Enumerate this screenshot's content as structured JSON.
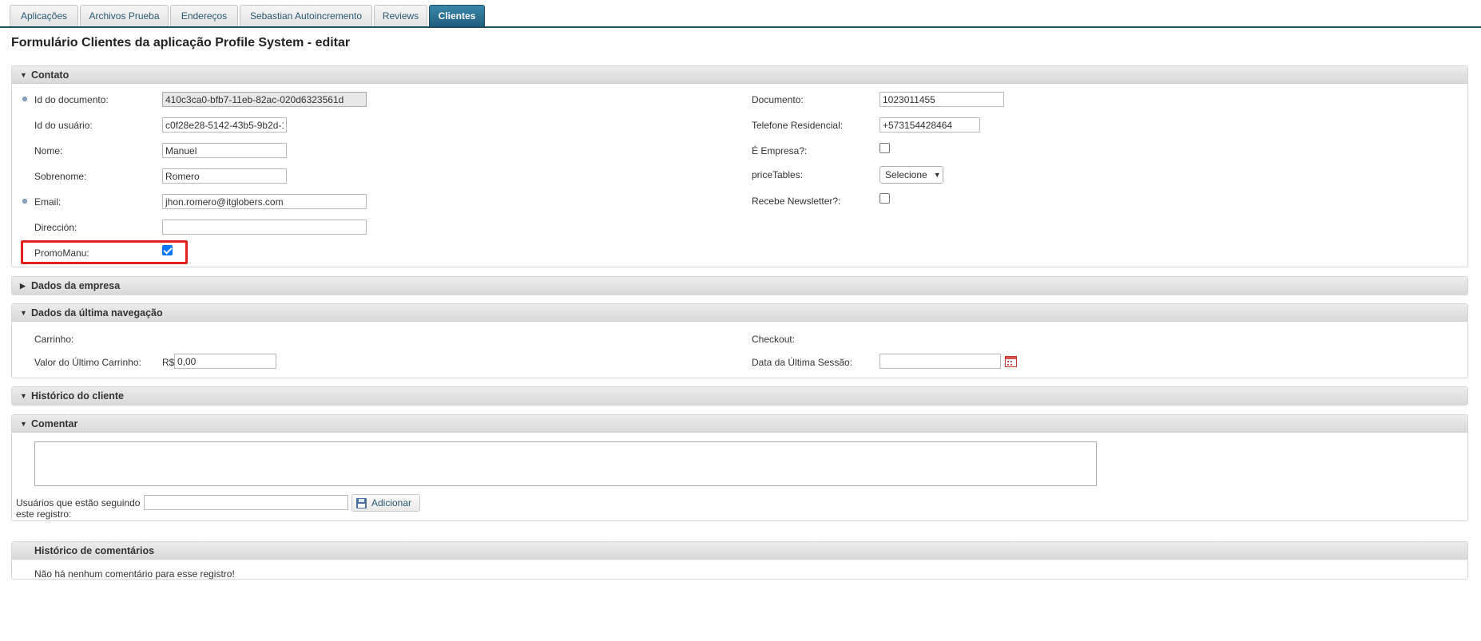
{
  "tabs": [
    {
      "label": "Aplicações",
      "active": false
    },
    {
      "label": "Archivos Prueba",
      "active": false
    },
    {
      "label": "Endereços",
      "active": false
    },
    {
      "label": "Sebastian Autoincremento",
      "active": false
    },
    {
      "label": "Reviews",
      "active": false
    },
    {
      "label": "Clientes",
      "active": true
    }
  ],
  "page_title": "Formulário Clientes da aplicação Profile System - editar",
  "contato": {
    "header": "Contato",
    "id_documento": {
      "label": "Id do documento:",
      "value": "410c3ca0-bfb7-11eb-82ac-020d6323561d"
    },
    "id_usuario": {
      "label": "Id do usuário:",
      "value": "c0f28e28-5142-43b5-9b2d-1"
    },
    "nome": {
      "label": "Nome:",
      "value": "Manuel"
    },
    "sobrenome": {
      "label": "Sobrenome:",
      "value": "Romero"
    },
    "email": {
      "label": "Email:",
      "value": "jhon.romero@itglobers.com"
    },
    "direccion": {
      "label": "Dirección:",
      "value": ""
    },
    "promomanu": {
      "label": "PromoManu:",
      "checked": true
    },
    "documento": {
      "label": "Documento:",
      "value": "1023011455"
    },
    "telefone": {
      "label": "Telefone Residencial:",
      "value": "+573154428464"
    },
    "e_empresa": {
      "label": "É Empresa?:",
      "checked": false
    },
    "price_tables": {
      "label": "priceTables:",
      "selected": "Selecione"
    },
    "newsletter": {
      "label": "Recebe Newsletter?:",
      "checked": false
    }
  },
  "dados_empresa": {
    "header": "Dados da empresa"
  },
  "ultima_navegacao": {
    "header": "Dados da última navegação",
    "carrinho": {
      "label": "Carrinho:"
    },
    "checkout": {
      "label": "Checkout:"
    },
    "valor_carrinho": {
      "label": "Valor do Último Carrinho:",
      "prefix": "R$",
      "value": "0,00"
    },
    "data_sessao": {
      "label": "Data da Última Sessão:",
      "value": ""
    }
  },
  "historico_cliente": {
    "header": "Histórico do cliente"
  },
  "comentar": {
    "header": "Comentar",
    "followers_label_line1": "Usuários que estão seguindo",
    "followers_label_line2": "este registro:",
    "followers_value": "",
    "add_button": "Adicionar"
  },
  "historico_comentarios": {
    "header": "Histórico de comentários",
    "empty_text": "Não há nenhum comentário para esse registro!"
  },
  "colors": {
    "tab_active": "#1f5f7f",
    "highlight": "#e61e1e",
    "checkbox_checked": "#0075ff"
  }
}
